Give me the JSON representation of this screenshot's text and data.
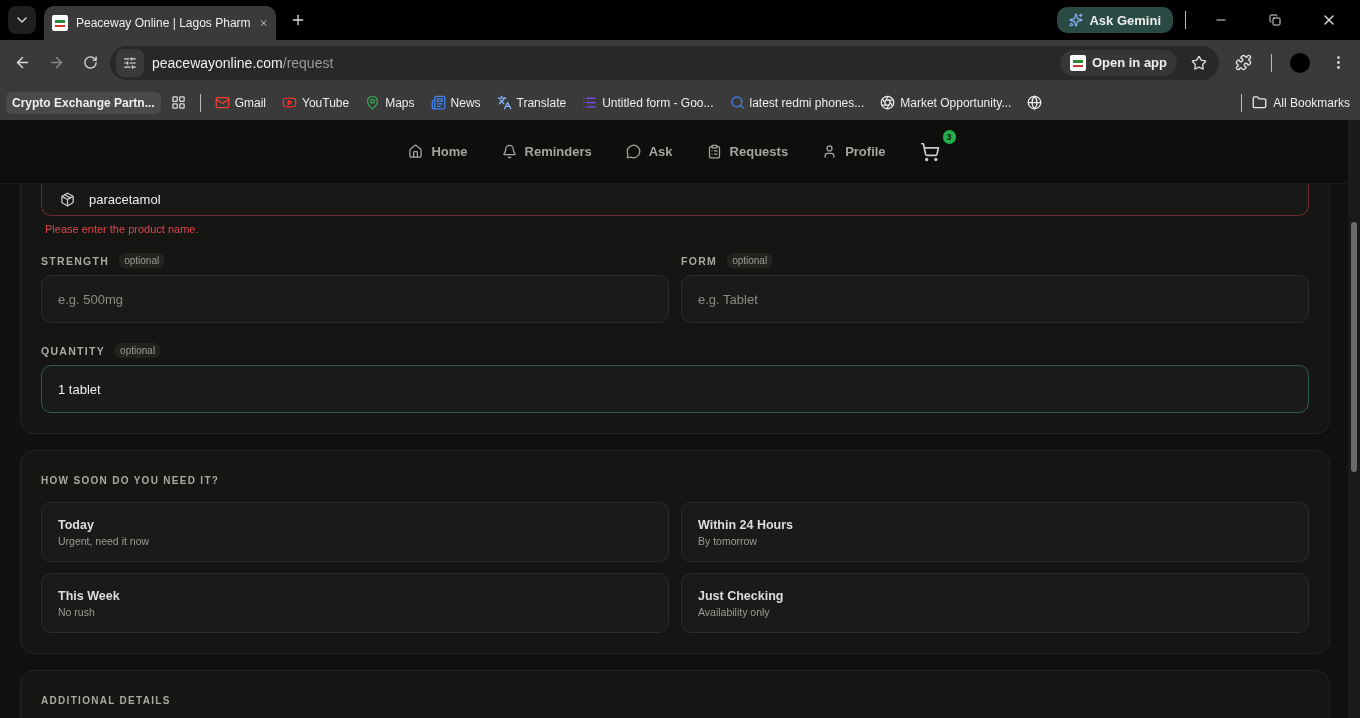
{
  "browser": {
    "tab": {
      "title": "Peaceway Online | Lagos Pharm",
      "selected": true
    },
    "ask_button": "Ask Gemini",
    "address": {
      "host": "peacewayonline.com",
      "path": "/request"
    },
    "open_in_app": "Open in app",
    "bookmarks": [
      {
        "kind": "chip",
        "label": "Crypto Exchange Partn..."
      },
      {
        "kind": "apps"
      },
      {
        "kind": "site",
        "label": "Gmail"
      },
      {
        "kind": "site",
        "label": "YouTube"
      },
      {
        "kind": "site",
        "label": "Maps"
      },
      {
        "kind": "site",
        "label": "News"
      },
      {
        "kind": "site",
        "label": "Translate"
      },
      {
        "kind": "site",
        "label": "Untitled form - Goo..."
      },
      {
        "kind": "site",
        "label": "latest redmi phones..."
      },
      {
        "kind": "site",
        "label": "Market Opportunity..."
      },
      {
        "kind": "site"
      }
    ],
    "all_bookmarks": "All Bookmarks"
  },
  "nav": {
    "items": [
      {
        "label": "Home"
      },
      {
        "label": "Reminders"
      },
      {
        "label": "Ask"
      },
      {
        "label": "Requests"
      },
      {
        "label": "Profile"
      }
    ],
    "cart_count": "3"
  },
  "product": {
    "value": "paracetamol",
    "invalid": true,
    "error": "Please enter the product name."
  },
  "fields": [
    {
      "label": "STRENGTH",
      "tag": "optional",
      "placeholder": "e.g. 500mg",
      "focused": false
    },
    {
      "label": "FORM",
      "tag": "optional",
      "placeholder": "e.g. Tablet",
      "focused": false
    }
  ],
  "quantity": {
    "label": "QUANTITY",
    "tag": "optional",
    "value": "1 tablet",
    "focused": true
  },
  "urgency": {
    "title": "HOW SOON DO YOU NEED IT?",
    "options": [
      {
        "title": "Today",
        "subtitle": "Urgent, need it now",
        "selected": false
      },
      {
        "title": "Within 24 Hours",
        "subtitle": "By tomorrow",
        "selected": false
      },
      {
        "title": "This Week",
        "subtitle": "No rush",
        "selected": false
      },
      {
        "title": "Just Checking",
        "subtitle": "Availability only",
        "selected": false
      }
    ]
  },
  "details": {
    "title": "ADDITIONAL DETAILS"
  }
}
